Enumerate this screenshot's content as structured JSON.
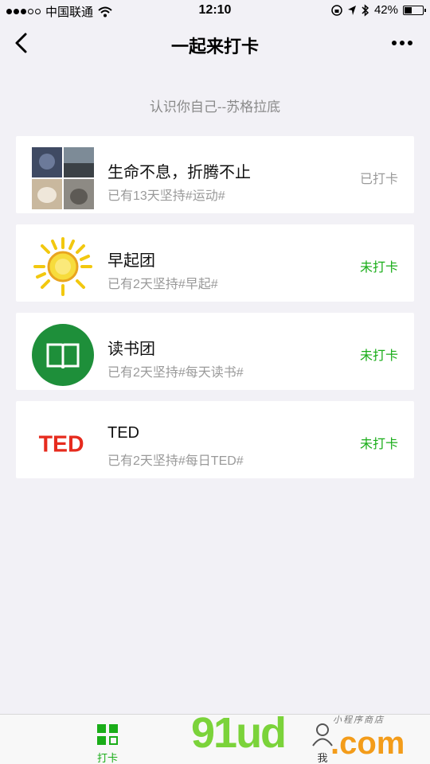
{
  "status_bar": {
    "carrier": "中国联通",
    "time": "12:10",
    "battery": "42%",
    "battery_level": 0.42
  },
  "nav": {
    "title": "一起来打卡"
  },
  "subtitle": "认识你自己--苏格拉底",
  "cards": [
    {
      "title": "生命不息，折腾不止",
      "sub": "已有13天坚持#运动#",
      "status": "已打卡"
    },
    {
      "title": "早起团",
      "sub": "已有2天坚持#早起#",
      "status": "未打卡"
    },
    {
      "title": "读书团",
      "sub": "已有2天坚持#每天读书#",
      "status": "未打卡"
    },
    {
      "title": "TED",
      "sub": "已有2天坚持#每日TED#",
      "status": "未打卡",
      "logo_text": "TED"
    }
  ],
  "tabs": [
    {
      "label": "打卡",
      "icon": "grid-icon"
    },
    {
      "label": "我",
      "icon": "person-icon"
    }
  ],
  "watermark": {
    "main": "91ud",
    "suffix": ".com",
    "small": "小程序商店"
  },
  "colors": {
    "accent_green": "#1aad19",
    "muted_gray": "#9a9a9a",
    "background": "#f2f1f6",
    "ted_red": "#e62b1e"
  }
}
